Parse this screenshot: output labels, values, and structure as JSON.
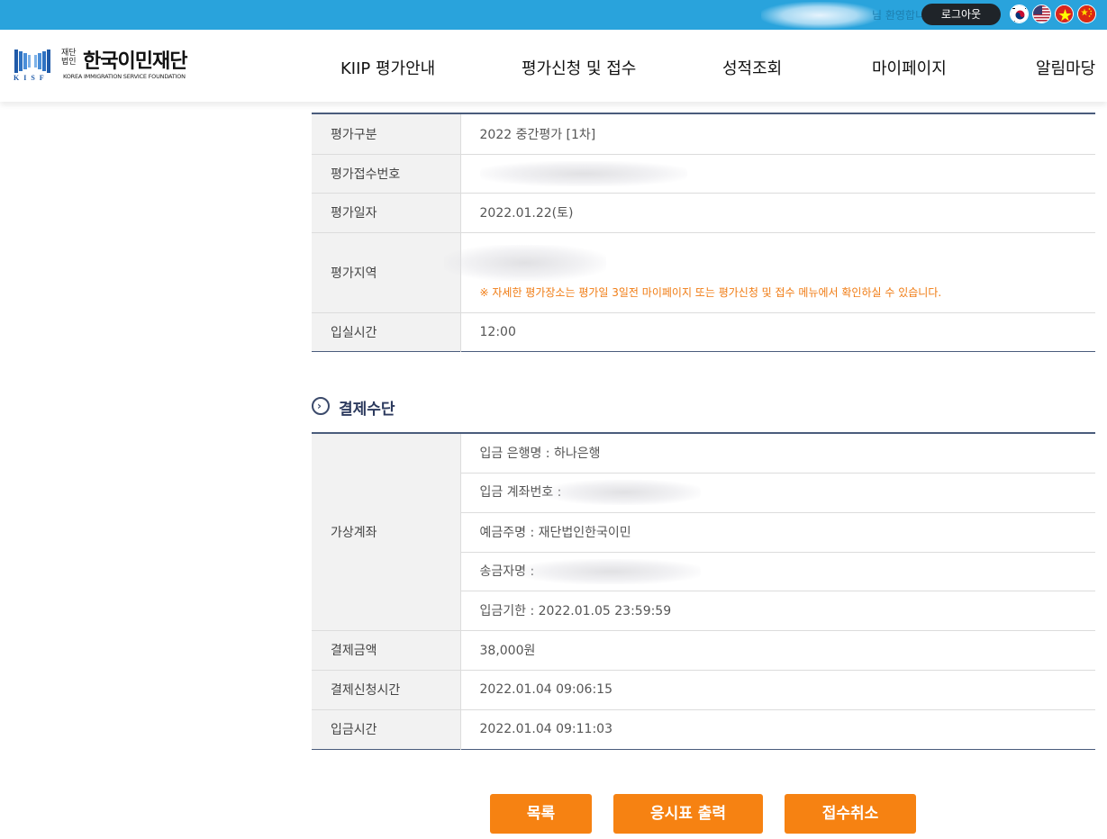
{
  "topbar": {
    "greeting": "님 환영합니다",
    "logout_label": "로그아웃",
    "languages": [
      "한국어",
      "English",
      "Tiếng Việt",
      "中文"
    ]
  },
  "logo": {
    "mark_text": "KISF",
    "small_text": "재단법인",
    "name": "한국이민재단",
    "english": "KOREA IMMIGRATION SERVICE FOUNDATION"
  },
  "nav": {
    "items": [
      "KIIP 평가안내",
      "평가신청 및 접수",
      "성적조회",
      "마이페이지",
      "알림마당"
    ]
  },
  "exam_info": {
    "rows": [
      {
        "label": "평가구분",
        "value": "2022 중간평가 [1차]"
      },
      {
        "label": "평가접수번호",
        "value": ""
      },
      {
        "label": "평가일자",
        "value": "2022.01.22(토)"
      },
      {
        "label": "평가지역",
        "value": "",
        "notice": "※ 자세한 평가장소는 평가일 3일전 마이페이지 또는 평가신청 및 접수 메뉴에서 확인하실 수 있습니다."
      },
      {
        "label": "입실시간",
        "value": "12:00"
      }
    ]
  },
  "payment": {
    "title": "결제수단",
    "virtual_account_label": "가상계좌",
    "account_lines": [
      {
        "label": "입금 은행명 :",
        "value": "하나은행"
      },
      {
        "label": "입금 계좌번호 :",
        "value": ""
      },
      {
        "label": "예금주명 :",
        "value": "재단법인한국이민"
      },
      {
        "label": "송금자명 :",
        "value": ""
      },
      {
        "label": "입금기한 :",
        "value": "2022.01.05 23:59:59"
      }
    ],
    "rows": [
      {
        "label": "결제금액",
        "value": "38,000원"
      },
      {
        "label": "결제신청시간",
        "value": "2022.01.04 09:06:15"
      },
      {
        "label": "입금시간",
        "value": "2022.01.04 09:11:03"
      }
    ]
  },
  "buttons": {
    "list": "목록",
    "print_ticket": "응시표 출력",
    "cancel": "접수취소"
  },
  "colors": {
    "topbar": "#29a3dc",
    "accent_orange": "#f68212",
    "notice_orange": "#f07c14",
    "table_border": "#4a5c7c",
    "header_cell": "#f2f2f2"
  }
}
